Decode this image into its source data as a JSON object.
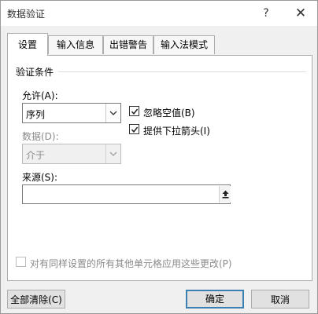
{
  "window": {
    "title": "数据验证",
    "help_glyph": "?",
    "close_glyph": "✕"
  },
  "tabs": [
    {
      "label": "设置",
      "active": true
    },
    {
      "label": "输入信息",
      "active": false
    },
    {
      "label": "出错警告",
      "active": false
    },
    {
      "label": "输入法模式",
      "active": false
    }
  ],
  "settings": {
    "group_title": "验证条件",
    "allow_label": "允许(A):",
    "allow_value": "序列",
    "data_label": "数据(D):",
    "data_value": "介于",
    "ignore_blank_label": "忽略空值(B)",
    "ignore_blank_checked": true,
    "in_cell_dropdown_label": "提供下拉箭头(I)",
    "in_cell_dropdown_checked": true,
    "source_label": "来源(S):",
    "source_value": "",
    "apply_all_label": "对有同样设置的所有其他单元格应用这些更改(P)",
    "apply_all_checked": false
  },
  "buttons": {
    "clear_all": "全部清除(C)",
    "ok": "确定",
    "cancel": "取消"
  },
  "icons": {
    "help": "help-icon",
    "close": "close-icon",
    "dropdown": "chevron-down-icon",
    "checkmark": "checkmark-icon",
    "collapse": "collapse-dialog-icon"
  }
}
